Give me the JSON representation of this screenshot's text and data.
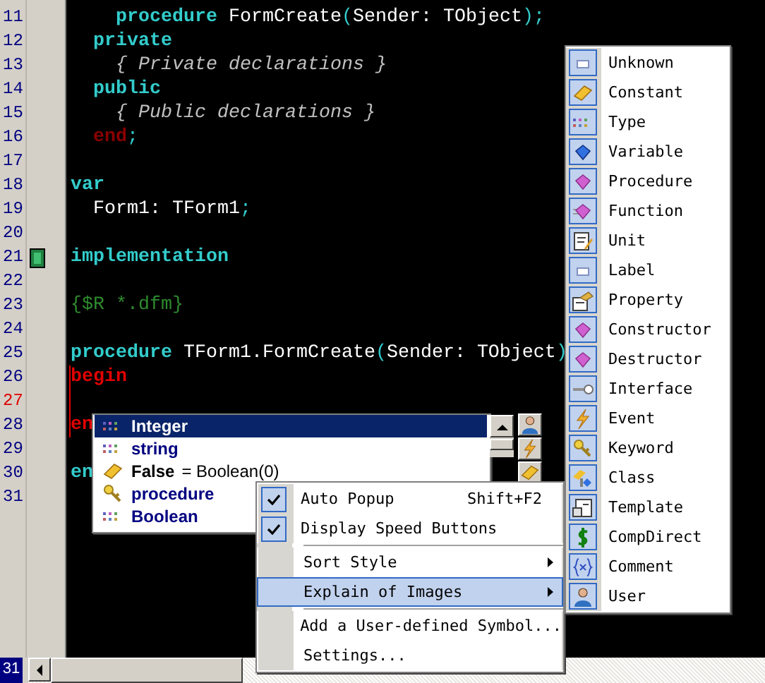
{
  "editor": {
    "lines": [
      {
        "number": "11",
        "current": false,
        "bracket": false,
        "tokens": [
          {
            "kind": "kw",
            "text": "    procedure"
          },
          {
            "kind": "id",
            "text": " FormCreate"
          },
          {
            "kind": "sym",
            "text": "("
          },
          {
            "kind": "id",
            "text": "Sender: TObject"
          },
          {
            "kind": "sym",
            "text": ");"
          }
        ]
      },
      {
        "number": "12",
        "current": false,
        "bracket": false,
        "tokens": [
          {
            "kind": "kw",
            "text": "  private"
          }
        ]
      },
      {
        "number": "13",
        "current": false,
        "bracket": false,
        "tokens": [
          {
            "kind": "comment",
            "text": "    { Private declarations }"
          }
        ]
      },
      {
        "number": "14",
        "current": false,
        "bracket": false,
        "tokens": [
          {
            "kind": "kw",
            "text": "  public"
          }
        ]
      },
      {
        "number": "15",
        "current": false,
        "bracket": false,
        "tokens": [
          {
            "kind": "comment",
            "text": "    { Public declarations }"
          }
        ]
      },
      {
        "number": "16",
        "current": false,
        "bracket": false,
        "tokens": [
          {
            "kind": "end",
            "text": "  end"
          },
          {
            "kind": "sym",
            "text": ";"
          }
        ]
      },
      {
        "number": "17",
        "current": false,
        "bracket": false
      },
      {
        "number": "18",
        "current": false,
        "bracket": false,
        "tokens": [
          {
            "kind": "kw",
            "text": "var"
          }
        ]
      },
      {
        "number": "19",
        "current": false,
        "bracket": false,
        "tokens": [
          {
            "kind": "id",
            "text": "  Form1: TForm1"
          },
          {
            "kind": "sym",
            "text": ";"
          }
        ]
      },
      {
        "number": "20",
        "current": false,
        "bracket": false
      },
      {
        "number": "21",
        "current": false,
        "bracket": false,
        "bookmark": true,
        "tokens": [
          {
            "kind": "kw",
            "text": "implementation"
          }
        ]
      },
      {
        "number": "22",
        "current": false,
        "bracket": false
      },
      {
        "number": "23",
        "current": false,
        "bracket": false,
        "tokens": [
          {
            "kind": "directive",
            "text": "{$R *.dfm}"
          }
        ]
      },
      {
        "number": "24",
        "current": false,
        "bracket": false
      },
      {
        "number": "25",
        "current": false,
        "bracket": false,
        "tokens": [
          {
            "kind": "kw",
            "text": "procedure"
          },
          {
            "kind": "id",
            "text": " TForm1.FormCreate"
          },
          {
            "kind": "sym",
            "text": "("
          },
          {
            "kind": "id",
            "text": "Sender: TObject"
          },
          {
            "kind": "sym",
            "text": ")"
          }
        ]
      },
      {
        "number": "26",
        "current": false,
        "bracket": true,
        "tokens": [
          {
            "kind": "match",
            "text": "begin"
          }
        ]
      },
      {
        "number": "27",
        "current": true,
        "bracket": true
      },
      {
        "number": "28",
        "current": false,
        "bracket": true,
        "tokens": [
          {
            "kind": "match",
            "text": "en"
          }
        ]
      },
      {
        "number": "29",
        "current": false,
        "bracket": false
      },
      {
        "number": "30",
        "current": false,
        "bracket": false,
        "tokens": [
          {
            "kind": "kw",
            "text": "en"
          }
        ]
      },
      {
        "number": "31",
        "current": false,
        "bracket": false
      }
    ]
  },
  "status": {
    "line": "31"
  },
  "completion": {
    "items": [
      {
        "kind": "type",
        "label": "Integer",
        "selected": true
      },
      {
        "kind": "type",
        "label": "string",
        "selected": false
      },
      {
        "kind": "constant",
        "label": "False",
        "detail": " = Boolean(0)",
        "selected": false
      },
      {
        "kind": "keyword",
        "label": "procedure",
        "selected": false
      },
      {
        "kind": "type",
        "label": "Boolean",
        "selected": false
      }
    ]
  },
  "context_menu": {
    "items": [
      {
        "kind": "item",
        "label": "Auto Popup",
        "shortcut": "Shift+F2",
        "checked": true,
        "selected": false
      },
      {
        "kind": "item",
        "label": "Display Speed Buttons",
        "checked": true,
        "selected": false
      },
      {
        "kind": "separator"
      },
      {
        "kind": "submenu",
        "label": "Sort Style",
        "checked": false,
        "selected": false
      },
      {
        "kind": "submenu",
        "label": "Explain of Images",
        "checked": false,
        "selected": true
      },
      {
        "kind": "separator"
      },
      {
        "kind": "item",
        "label": "Add a User-defined Symbol...",
        "checked": false,
        "selected": false
      },
      {
        "kind": "item",
        "label": "Settings...",
        "checked": false,
        "selected": false
      }
    ]
  },
  "submenu": {
    "items": [
      {
        "kind": "unknown",
        "label": "Unknown"
      },
      {
        "kind": "constant",
        "label": "Constant"
      },
      {
        "kind": "type",
        "label": "Type"
      },
      {
        "kind": "variable",
        "label": "Variable"
      },
      {
        "kind": "procedure",
        "label": "Procedure"
      },
      {
        "kind": "function",
        "label": "Function"
      },
      {
        "kind": "unit",
        "label": "Unit"
      },
      {
        "kind": "label",
        "label": "Label"
      },
      {
        "kind": "property",
        "label": "Property"
      },
      {
        "kind": "constructor",
        "label": "Constructor"
      },
      {
        "kind": "destructor",
        "label": "Destructor"
      },
      {
        "kind": "interface",
        "label": "Interface"
      },
      {
        "kind": "event",
        "label": "Event"
      },
      {
        "kind": "keyword",
        "label": "Keyword"
      },
      {
        "kind": "class",
        "label": "Class"
      },
      {
        "kind": "template",
        "label": "Template"
      },
      {
        "kind": "compdirect",
        "label": "CompDirect"
      },
      {
        "kind": "comment",
        "label": "Comment"
      },
      {
        "kind": "user",
        "label": "User"
      }
    ]
  }
}
